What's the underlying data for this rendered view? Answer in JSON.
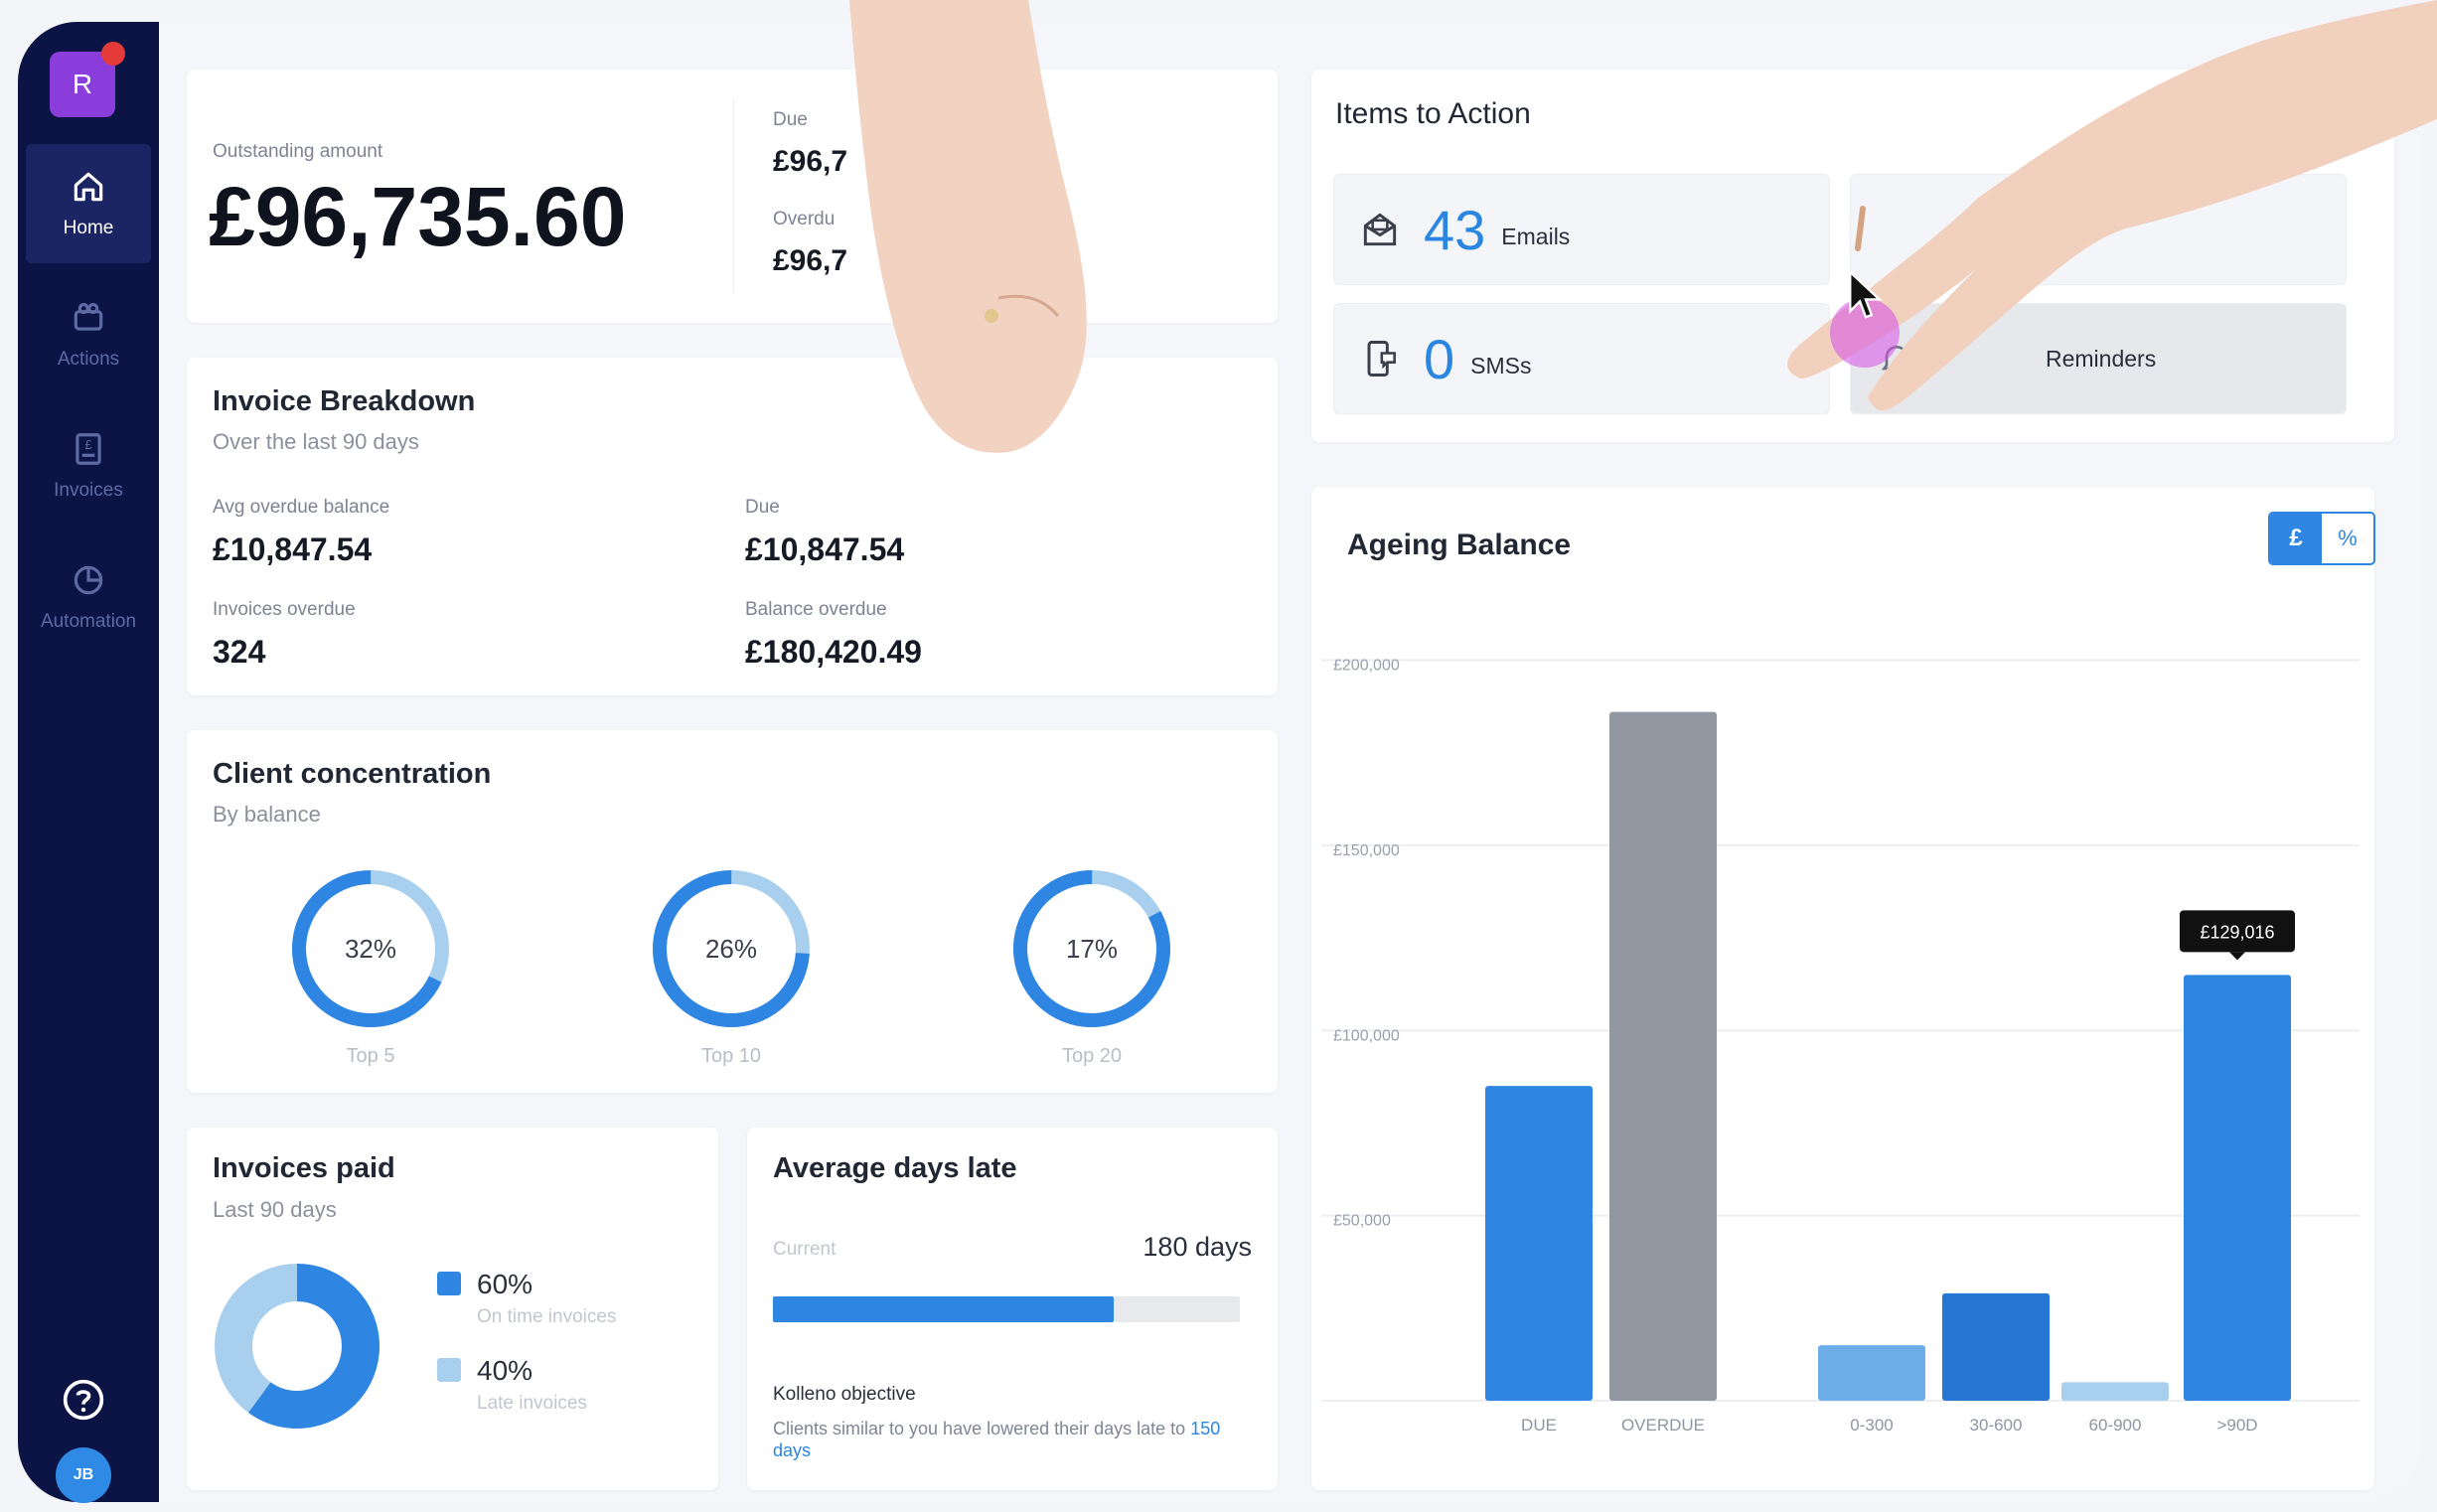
{
  "sidebar": {
    "brand_initial": "R",
    "items": [
      {
        "label": "Home",
        "icon": "home-icon",
        "active": true
      },
      {
        "label": "Actions",
        "icon": "actions-icon",
        "active": false
      },
      {
        "label": "Invoices",
        "icon": "invoice-icon",
        "active": false
      },
      {
        "label": "Automation",
        "icon": "pie-chart-icon",
        "active": false
      }
    ],
    "user_initials": "JB"
  },
  "outstanding": {
    "label": "Outstanding amount",
    "amount": "£96,735.60",
    "due_label": "Due",
    "due_value": "£96,7",
    "overdue_label": "Overdu",
    "overdue_value": "£96,7"
  },
  "invoice_breakdown": {
    "title": "Invoice Breakdown",
    "subtitle": "Over the last 90 days",
    "avg_overdue_label": "Avg overdue balance",
    "avg_overdue_value": "£10,847.54",
    "due_label": "Due",
    "due_value": "£10,847.54",
    "invoices_overdue_label": "Invoices overdue",
    "invoices_overdue_value": "324",
    "balance_overdue_label": "Balance overdue",
    "balance_overdue_value": "£180,420.49"
  },
  "client_concentration": {
    "title": "Client concentration",
    "subtitle": "By balance",
    "donuts": [
      {
        "value": "32%",
        "label": "Top 5",
        "fraction": 0.32
      },
      {
        "value": "26%",
        "label": "Top 10",
        "fraction": 0.26
      },
      {
        "value": "17%",
        "label": "Top 20",
        "fraction": 0.17
      }
    ]
  },
  "invoices_paid": {
    "title": "Invoices paid",
    "subtitle": "Last 90 days",
    "legend": [
      {
        "pct": "60%",
        "label": "On time invoices",
        "color": "#2f86e2"
      },
      {
        "pct": "40%",
        "label": "Late invoices",
        "color": "#a9cfee"
      }
    ]
  },
  "avg_days_late": {
    "title": "Average days late",
    "current_label": "Current",
    "current_value": "180 days",
    "progress": 0.73,
    "objective_title": "Kolleno objective",
    "objective_text": "Clients similar to you have lowered their days late to",
    "objective_link": "150 days"
  },
  "items_to_action": {
    "title": "Items to Action",
    "emails_count": "43",
    "emails_label": "Emails",
    "sms_count": "0",
    "sms_label": "SMSs",
    "reminders_label": "Reminders"
  },
  "ageing": {
    "title": "Ageing Balance",
    "toggle_currency": "£",
    "toggle_percent": "%"
  },
  "chart_data": {
    "type": "bar",
    "title": "Ageing Balance",
    "categories": [
      "DUE",
      "OVERDUE",
      "0-300",
      "30-600",
      "60-900",
      ">90D"
    ],
    "values": [
      85000,
      186000,
      15000,
      29000,
      5000,
      115000
    ],
    "colors": [
      "#2f86e2",
      "#9197a1",
      "#6daeea",
      "#2677d3",
      "#a9cfee",
      "#2f86e2"
    ],
    "yticks": [
      "£200,000",
      "£150,000",
      "£100,000",
      "£50,000"
    ],
    "ylim": [
      0,
      200000
    ],
    "tooltip": "£129,016"
  }
}
